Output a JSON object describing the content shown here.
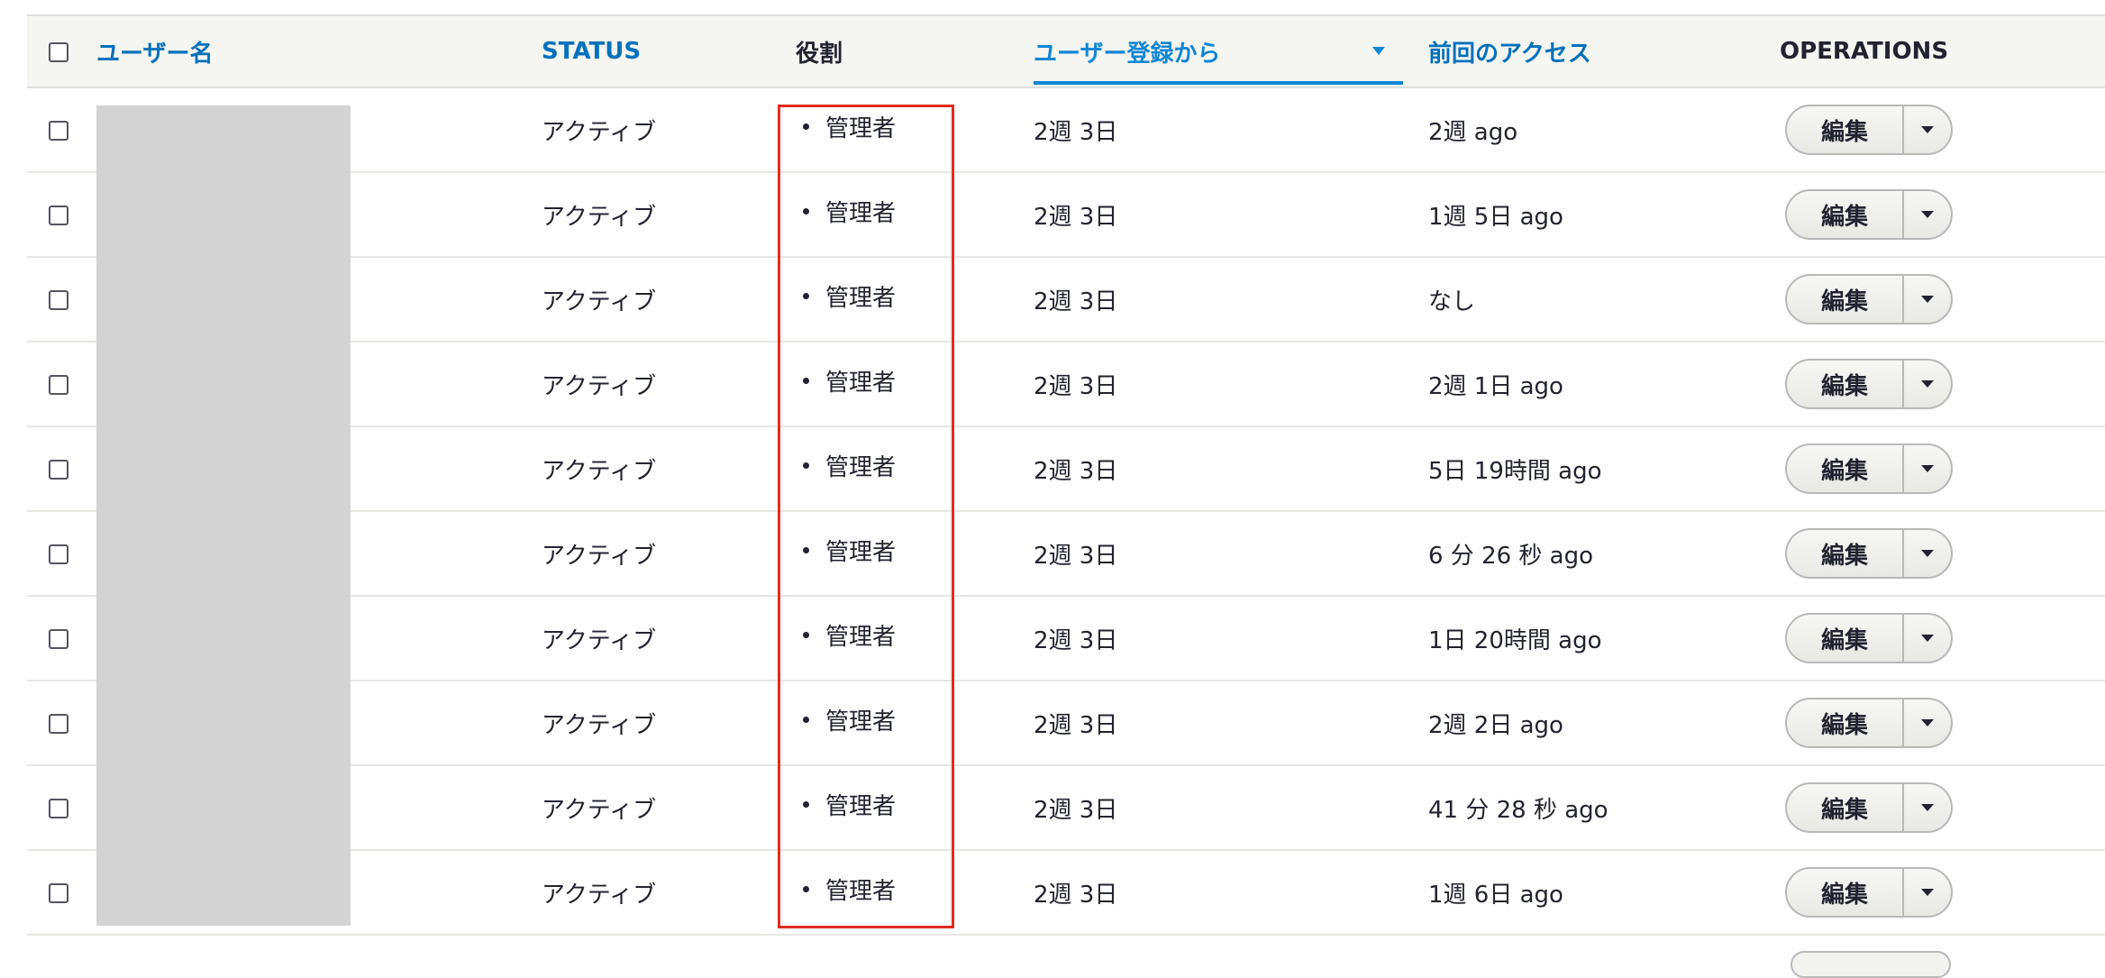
{
  "table": {
    "headers": {
      "username": "ユーザー名",
      "status": "STATUS",
      "roles": "役割",
      "member_for": "ユーザー登録から",
      "last_access": "前回のアクセス",
      "operations": "OPERATIONS"
    },
    "rows": [
      {
        "status": "アクティブ",
        "role": "管理者",
        "member_for": "2週 3日",
        "last_access": "2週 ago",
        "edit": "編集"
      },
      {
        "status": "アクティブ",
        "role": "管理者",
        "member_for": "2週 3日",
        "last_access": "1週 5日 ago",
        "edit": "編集"
      },
      {
        "status": "アクティブ",
        "role": "管理者",
        "member_for": "2週 3日",
        "last_access": "なし",
        "edit": "編集"
      },
      {
        "status": "アクティブ",
        "role": "管理者",
        "member_for": "2週 3日",
        "last_access": "2週 1日 ago",
        "edit": "編集"
      },
      {
        "status": "アクティブ",
        "role": "管理者",
        "member_for": "2週 3日",
        "last_access": "5日 19時間 ago",
        "edit": "編集"
      },
      {
        "status": "アクティブ",
        "role": "管理者",
        "member_for": "2週 3日",
        "last_access": "6 分 26 秒 ago",
        "edit": "編集"
      },
      {
        "status": "アクティブ",
        "role": "管理者",
        "member_for": "2週 3日",
        "last_access": "1日 20時間 ago",
        "edit": "編集"
      },
      {
        "status": "アクティブ",
        "role": "管理者",
        "member_for": "2週 3日",
        "last_access": "2週 2日 ago",
        "edit": "編集"
      },
      {
        "status": "アクティブ",
        "role": "管理者",
        "member_for": "2週 3日",
        "last_access": "41 分 28 秒 ago",
        "edit": "編集"
      },
      {
        "status": "アクティブ",
        "role": "管理者",
        "member_for": "2週 3日",
        "last_access": "1週 6日 ago",
        "edit": "編集"
      }
    ]
  },
  "colors": {
    "link": "#0071bc",
    "active_sort": "#0f86d6",
    "highlight_box": "#e32b1e",
    "redaction": "#d3d3d3",
    "header_bg": "#f5f5f2"
  },
  "icons": {
    "sort": "sort-descending-icon",
    "dropdown": "chevron-down-icon"
  }
}
